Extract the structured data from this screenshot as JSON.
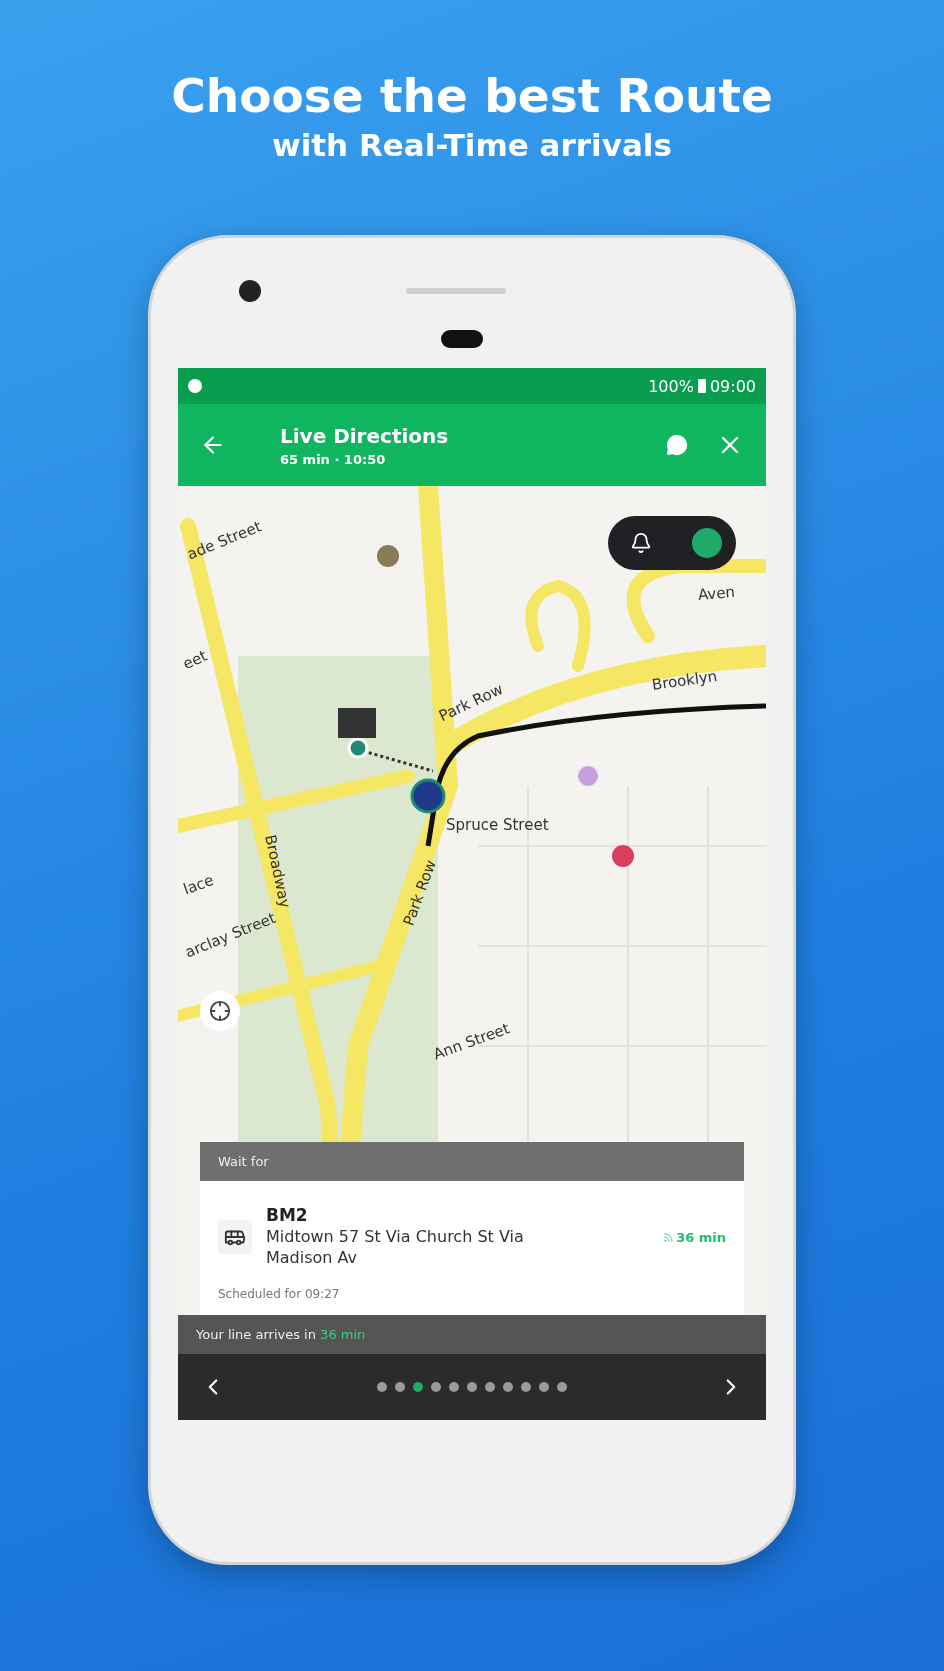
{
  "headline": {
    "title": "Choose the best Route",
    "subtitle": "with Real-Time arrivals"
  },
  "status_bar": {
    "battery": "100%",
    "time": "09:00"
  },
  "app_bar": {
    "title": "Live Directions",
    "subtitle": "65 min · 10:50"
  },
  "alert_toggle": {
    "on": true
  },
  "map_labels": [
    "ade Street",
    "eet",
    "Park Row",
    "Brooklyn",
    "Aven",
    "Spruce Street",
    "Broadway",
    "Park Row",
    "lace",
    "arclay Street",
    "Ann Street"
  ],
  "wait_panel": {
    "header": "Wait for",
    "line": "BM2",
    "destination": "Midtown 57 St Via Church St Via Madison Av",
    "eta": "36 min",
    "scheduled": "Scheduled for 09:27"
  },
  "arrival_bar": {
    "prefix": "Your line arrives in",
    "eta": "36 min"
  },
  "steps": [
    {
      "selected": false
    },
    {
      "selected": false
    },
    {
      "selected": true
    },
    {
      "selected": false
    },
    {
      "selected": false
    },
    {
      "selected": false
    },
    {
      "selected": false
    },
    {
      "selected": false
    },
    {
      "selected": false
    },
    {
      "selected": false
    },
    {
      "selected": false
    }
  ]
}
